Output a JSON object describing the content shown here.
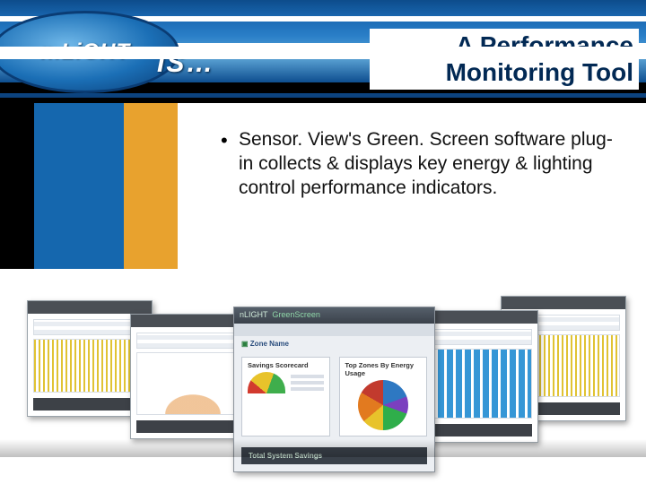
{
  "header": {
    "logo_main": "n.LiGHT",
    "logo_tail": "IS…",
    "title": "A Performance Monitoring Tool"
  },
  "bullets": [
    "Sensor. View's Green. Screen software plug-in collects & displays key energy & lighting control performance indicators."
  ],
  "dashboard": {
    "brand": "nLIGHT",
    "brand_sub": "GreenScreen",
    "zone_label": "Zone Name",
    "card_savings_title": "Savings Scorecard",
    "card_breakdown_title": "Top Zones By Energy Usage",
    "total_title": "Total System Savings"
  }
}
